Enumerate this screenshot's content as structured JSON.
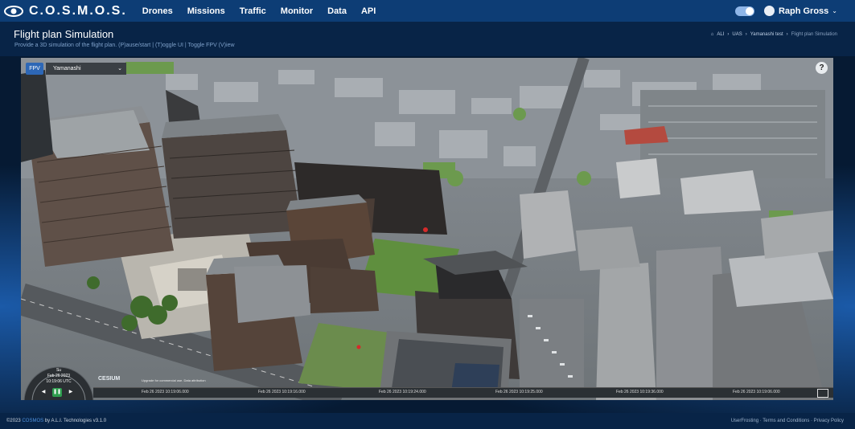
{
  "navbar": {
    "brand": "C.O.S.M.O.S.",
    "items": [
      {
        "label": "Drones"
      },
      {
        "label": "Missions"
      },
      {
        "label": "Traffic"
      },
      {
        "label": "Monitor"
      },
      {
        "label": "Data"
      },
      {
        "label": "API"
      }
    ],
    "user_name": "Raph Gross",
    "caret": "⌄"
  },
  "header": {
    "title": "Flight plan Simulation",
    "subtitle": "Provide a 3D simulation of the flight plan. (P)ause/start | (T)oggle UI | Toggle FPV (V)iew",
    "breadcrumb": [
      "ALI",
      "UAS",
      "Yamanashi test",
      "Flight plan Simulation"
    ],
    "breadcrumb_sep": "›"
  },
  "viewer": {
    "fpv_label": "FPV",
    "location_value": "Yamanashi",
    "location_caret": "⌄",
    "help_label": "?",
    "clock": {
      "day": "Su",
      "date": "Feb 26 2023",
      "time": "10:19:06 UTC"
    },
    "playback": {
      "rewind": "◀",
      "pause": "❚❚",
      "forward": "▶"
    },
    "timeline_ticks": [
      "Feb 26 2023 10:19:06.000",
      "Feb 26 2023 10:19:16.000",
      "Feb 26 2023 10:19:24.000",
      "Feb 26 2023 10:19:25.000",
      "Feb 26 2023 10:19:36.000",
      "Feb 26 2023 10:19:06.000"
    ],
    "cesium_logo": "CESIUM",
    "cesium_sub": "Upgrade for commercial use.   Data attribution"
  },
  "footer": {
    "copyright": "©2023 ",
    "product": "COSMOS",
    "company": " by A.L.I. Technologies v3.1.0",
    "right": "UserFrosting · Terms and Conditions · Privacy Policy"
  }
}
